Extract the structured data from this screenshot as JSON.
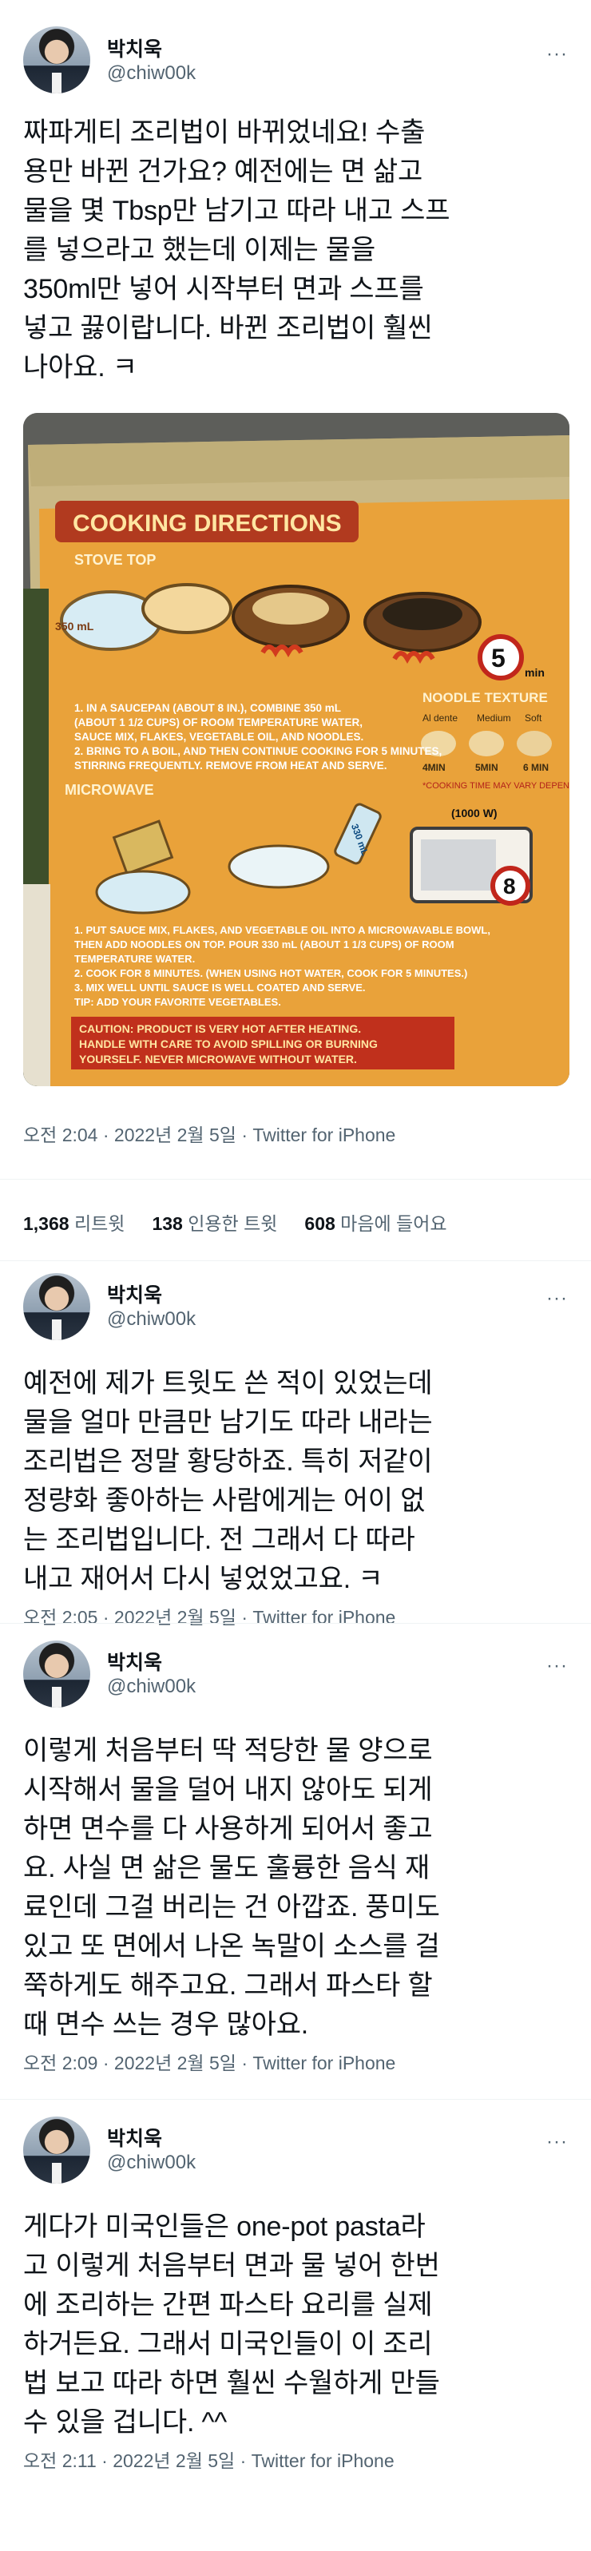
{
  "tweets": [
    {
      "author_name": "박치욱",
      "author_handle": "@chiw00k",
      "text": "짜파게티 조리법이 바뀌었네요! 수출\n용만 바뀐 건가요? 예전에는 면 삶고\n물을 몇 Tbsp만 남기고 따라 내고 스프\n를 넣으라고 했는데 이제는 물을\n350ml만 넣어 시작부터 면과 스프를\n넣고 끓이랍니다. 바뀐 조리법이 훨씬\n나아요. ㅋ",
      "meta": "오전 2:04 · 2022년 2월 5일 · Twitter for iPhone",
      "stats": {
        "retweets_count": "1,368",
        "retweets_label": "리트윗",
        "quotes_count": "138",
        "quotes_label": "인용한 트윗",
        "likes_count": "608",
        "likes_label": "마음에 들어요"
      },
      "photo": {
        "heading": "COOKING DIRECTIONS",
        "stove_top": "STOVE TOP",
        "measure": "350 mL",
        "timer_stove": "5",
        "timer_unit": "min",
        "noodle_texture": "NOODLE TEXTURE",
        "texture_levels": [
          "Al dente",
          "Medium",
          "Soft"
        ],
        "texture_times": [
          "4MIN",
          "5MIN",
          "6 MIN"
        ],
        "note": "*COOKING TIME MAY VARY DEPENDING ON MICROWAVE.",
        "microwave_power": "(1000 W)",
        "stove_steps": [
          "1. IN A SAUCEPAN (ABOUT 8 IN.), COMBINE 350 mL",
          "(ABOUT 1 1/2 CUPS) OF ROOM TEMPERATURE WATER,",
          "SAUCE MIX, FLAKES, VEGETABLE OIL, AND NOODLES.",
          "2. BRING TO A BOIL, AND THEN CONTINUE COOKING FOR 5 MINUTES,",
          "STIRRING FREQUENTLY. REMOVE FROM HEAT AND SERVE."
        ],
        "microwave": "MICROWAVE",
        "timer_microwave": "8",
        "microwave_steps": [
          "1. PUT SAUCE MIX, FLAKES, AND VEGETABLE OIL INTO A MICROWAVABLE BOWL,",
          "THEN ADD NOODLES ON TOP. POUR 330 mL (ABOUT 1 1/3 CUPS) OF ROOM",
          "TEMPERATURE WATER.",
          "2. COOK FOR 8 MINUTES. (WHEN USING HOT WATER, COOK FOR 5 MINUTES.)",
          "3. MIX WELL UNTIL SAUCE IS WELL COATED AND SERVE.",
          "TIP: ADD YOUR FAVORITE VEGETABLES."
        ],
        "caution": [
          "CAUTION: PRODUCT IS VERY HOT AFTER HEATING.",
          "HANDLE WITH CARE TO AVOID SPILLING OR BURNING",
          "YOURSELF. NEVER MICROWAVE WITHOUT WATER."
        ],
        "mw_measure": "330 mL"
      }
    },
    {
      "author_name": "박치욱",
      "author_handle": "@chiw00k",
      "text": "예전에 제가 트윗도 쓴 적이 있었는데\n물을 얼마 만큼만 남기도 따라 내라는\n조리법은 정말 황당하죠. 특히 저같이\n정량화 좋아하는 사람에게는 어이 없\n는 조리법입니다. 전 그래서 다 따라\n내고 재어서 다시 넣었었고요. ㅋ",
      "meta": "오전 2:05 · 2022년 2월 5일 · Twitter for iPhone"
    },
    {
      "author_name": "박치욱",
      "author_handle": "@chiw00k",
      "text": "이렇게 처음부터 딱 적당한 물 양으로\n시작해서 물을 덜어 내지 않아도 되게\n하면 면수를 다 사용하게 되어서 좋고\n요. 사실 면 삶은 물도 훌륭한 음식 재\n료인데 그걸 버리는 건 아깝죠. 풍미도\n있고 또 면에서 나온 녹말이 소스를 걸\n쭉하게도 해주고요. 그래서 파스타 할\n때 면수 쓰는 경우 많아요.",
      "meta": "오전 2:09 · 2022년 2월 5일 · Twitter for iPhone"
    },
    {
      "author_name": "박치욱",
      "author_handle": "@chiw00k",
      "text": "게다가 미국인들은 one-pot pasta라\n고 이렇게 처음부터 면과 물 넣어 한번\n에 조리하는 간편 파스타 요리를 실제\n하거든요. 그래서 미국인들이 이 조리\n법 보고 따라 하면 훨씬 수월하게 만들\n수 있을 겁니다. ^^",
      "meta": "오전 2:11 · 2022년 2월 5일 · Twitter for iPhone"
    }
  ],
  "icons": {
    "more": "more-dots-icon"
  },
  "colors": {
    "text": "#0f1419",
    "secondary": "#536471",
    "divider": "#eff3f4"
  }
}
